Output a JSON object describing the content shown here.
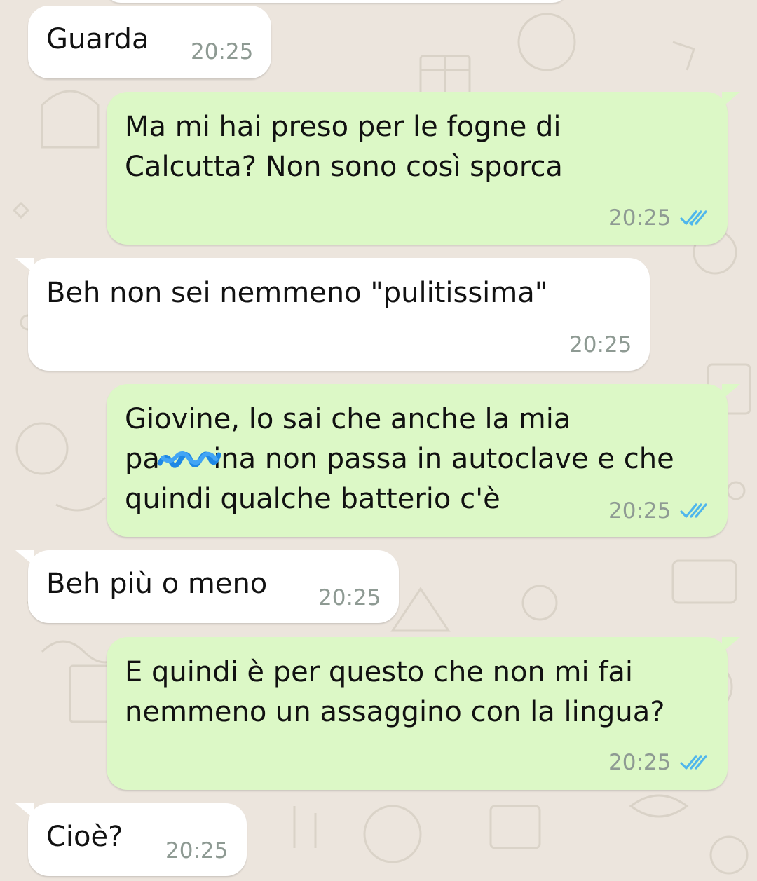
{
  "messages": [
    {
      "direction": "incoming",
      "text": "Guarda",
      "time": "20:25"
    },
    {
      "direction": "outgoing",
      "text": "Ma mi hai preso per le fogne di\nCalcutta? Non sono così sporca",
      "time": "20:25",
      "status": "read"
    },
    {
      "direction": "incoming",
      "text": "Beh non sei nemmeno \"pulitissima\"",
      "time": "20:25"
    },
    {
      "direction": "outgoing",
      "text": "Giovine, lo sai che anche la mia\npa      ina non passa in autoclave e che\nquindi qualche batterio c'è",
      "time": "20:25",
      "status": "read"
    },
    {
      "direction": "incoming",
      "text": "Beh più o meno",
      "time": "20:25"
    },
    {
      "direction": "outgoing",
      "text": "E quindi è per questo che non mi fai\nnemmeno un assaggino con la lingua?",
      "time": "20:25",
      "status": "read"
    },
    {
      "direction": "incoming",
      "text": "Cioè?",
      "time": "20:25"
    }
  ],
  "colors": {
    "background": "#ece5dd",
    "incoming_bubble": "#ffffff",
    "outgoing_bubble": "#dcf8c6",
    "read_ticks": "#4fb6ec",
    "redaction_scribble": "#1e88e5"
  },
  "icons": {
    "read_receipt": "double-check-icon",
    "redaction": "scribble-redaction"
  }
}
